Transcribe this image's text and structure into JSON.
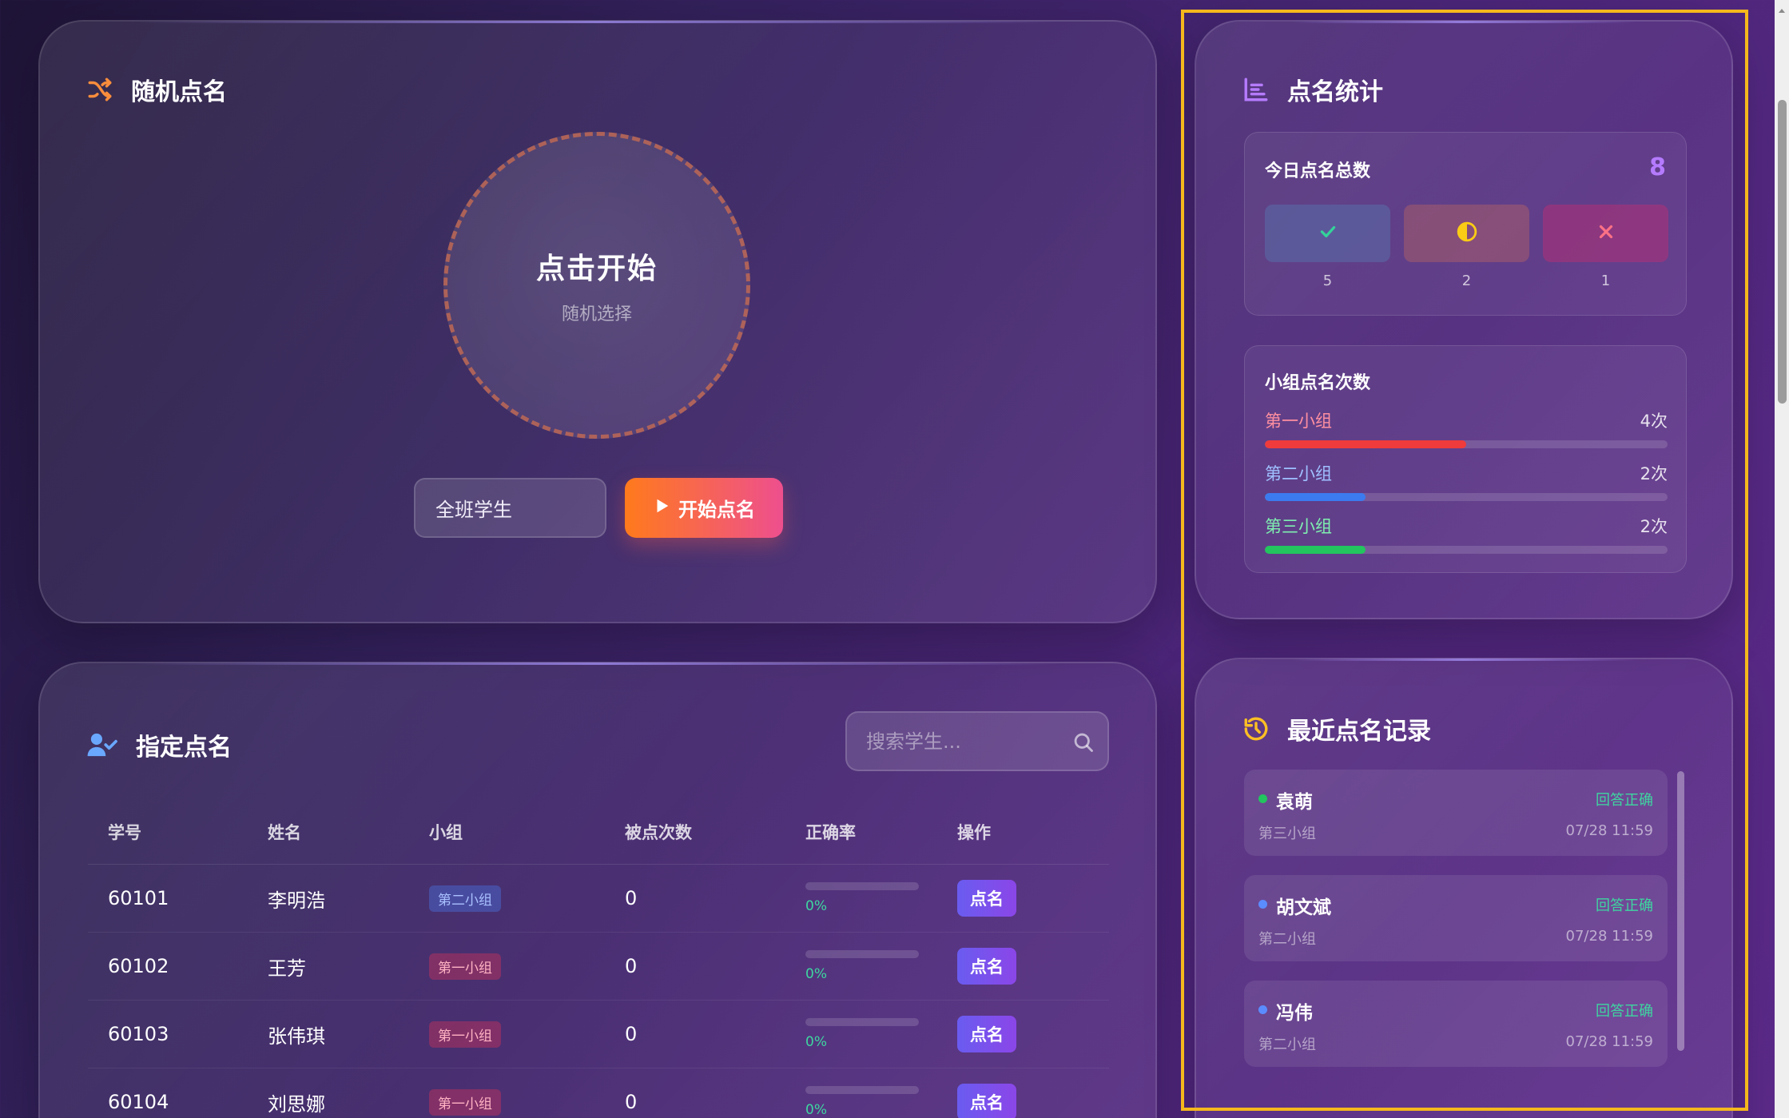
{
  "random_call": {
    "title": "随机点名",
    "wheel_main": "点击开始",
    "wheel_sub": "随机选择",
    "scope_select": "全班学生",
    "start_button": "开始点名"
  },
  "designated_call": {
    "title": "指定点名",
    "search_placeholder": "搜索学生...",
    "columns": [
      "学号",
      "姓名",
      "小组",
      "被点次数",
      "正确率",
      "操作"
    ],
    "rows": [
      {
        "id": "60101",
        "name": "李明浩",
        "group": "第二小组",
        "count": "0",
        "rate": "0%",
        "action": "点名"
      },
      {
        "id": "60102",
        "name": "王芳",
        "group": "第一小组",
        "count": "0",
        "rate": "0%",
        "action": "点名"
      },
      {
        "id": "60103",
        "name": "张伟琪",
        "group": "第一小组",
        "count": "0",
        "rate": "0%",
        "action": "点名"
      },
      {
        "id": "60104",
        "name": "刘思娜",
        "group": "第一小组",
        "count": "0",
        "rate": "0%",
        "action": "点名"
      }
    ]
  },
  "stats": {
    "title": "点名统计",
    "today_label": "今日点名总数",
    "today_total": "8",
    "correct_count": "5",
    "partial_count": "2",
    "wrong_count": "1",
    "group_label": "小组点名次数",
    "groups": [
      {
        "name": "第一小组",
        "count": "4次",
        "fraction": 0.5,
        "color": "#ef3b3b",
        "label_color": "#ff8fa0"
      },
      {
        "name": "第二小组",
        "count": "2次",
        "fraction": 0.25,
        "color": "#3b7bef",
        "label_color": "#9fc0ff"
      },
      {
        "name": "第三小组",
        "count": "2次",
        "fraction": 0.25,
        "color": "#22c55e",
        "label_color": "#7ff0b0"
      }
    ]
  },
  "recent": {
    "title": "最近点名记录",
    "items": [
      {
        "name": "袁萌",
        "status": "回答正确",
        "group": "第三小组",
        "time": "07/28 11:59",
        "dot": "#22c55e"
      },
      {
        "name": "胡文斌",
        "status": "回答正确",
        "group": "第二小组",
        "time": "07/28 11:59",
        "dot": "#5b8cff"
      },
      {
        "name": "冯伟",
        "status": "回答正确",
        "group": "第二小组",
        "time": "07/28 11:59",
        "dot": "#5b8cff"
      }
    ]
  },
  "colors": {
    "accent_orange": "#f97316",
    "accent_purple": "#8b5cf6",
    "highlight": "#f5b81c"
  },
  "icons": {
    "random": "shuffle-icon",
    "designated": "user-check-icon",
    "stats": "bar-chart-icon",
    "recent": "history-icon"
  }
}
